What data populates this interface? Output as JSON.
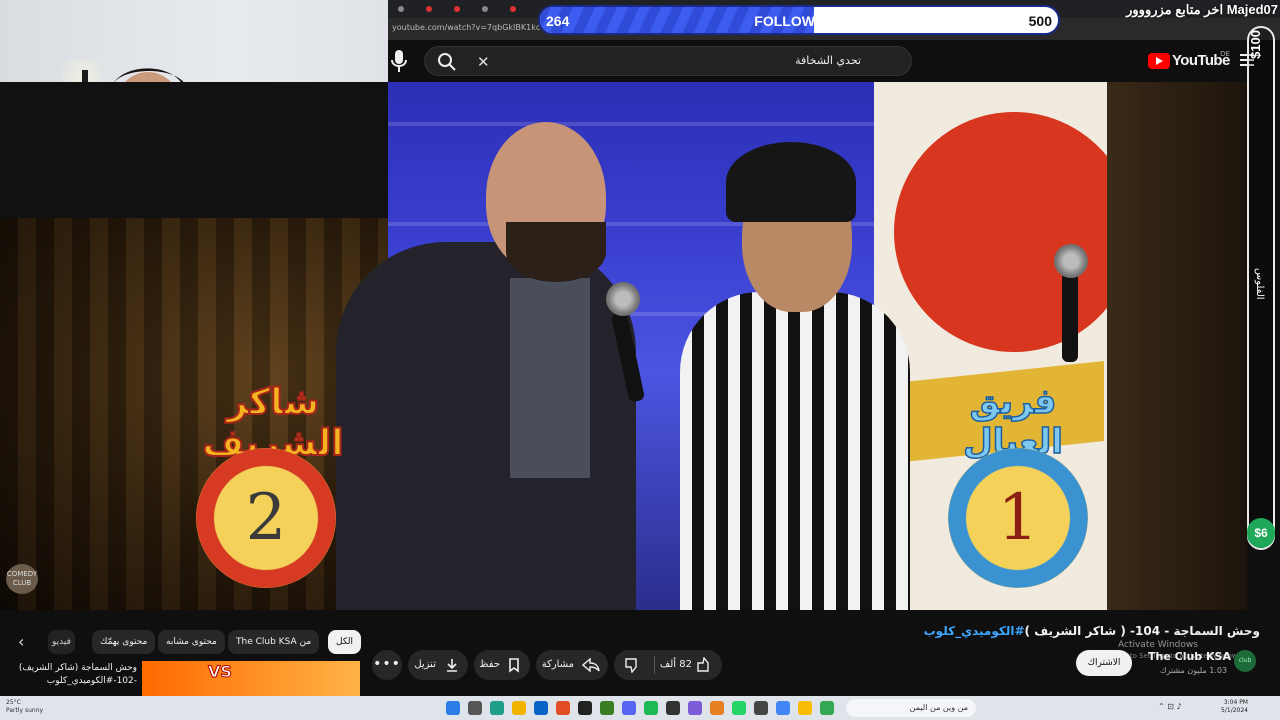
{
  "browser": {
    "url": "youtube.com/watch?v=7qbGkIBK1kc"
  },
  "overlay": {
    "followers_current": "264",
    "followers_label": "FOLLOWERS",
    "followers_goal": "500",
    "followers_progress": 0.528,
    "latest_follower": "اخر متابع مزرووور Majed07",
    "side_top": "$100",
    "side_mid": "الفلوس",
    "side_bottom": "$6"
  },
  "youtube": {
    "logo_text": "YouTube",
    "region": "DE",
    "search_query": "تحدي الشخافة",
    "video_title": "وحش السماجة - 104- ( شاكر الشريف )",
    "video_hashtag": "#الكوميدي_كلوب",
    "chips": [
      {
        "label": "الكل",
        "active": true
      },
      {
        "label": "من The Club KSA",
        "active": false
      },
      {
        "label": "محتوى مشابه",
        "active": false
      },
      {
        "label": "محتوى يهمّك",
        "active": false
      },
      {
        "label": "فيديو",
        "active": false
      }
    ],
    "related_title": "وحش السماجة (شاكر الشريف) -102-#الكوميدي_كلوب",
    "thumb_vs": "VS",
    "actions": {
      "like_count": "82 ألف",
      "share": "مشاركة",
      "save": "حفظ",
      "download": "تنزيل",
      "more": "•••"
    },
    "channel_name": "The Club KSA",
    "channel_subs": "1.03 مليون مشترك",
    "subscribe": "الاشتراك",
    "channel_avatar_text": "club"
  },
  "scene": {
    "left_name": "شاكر الشريف",
    "left_score": "2",
    "right_name": "فريق العيال",
    "right_score": "1",
    "watermark": "COMEDY CLUB"
  },
  "windows": {
    "activate_title": "Activate Windows",
    "activate_sub": "Go to Settings to activate Windows.",
    "taskbar_search": "من وين من اليمن",
    "weather_temp": "25°C",
    "weather_desc": "Partly sunny",
    "clock_time": "3:04 PM",
    "clock_date": "5/1/2024",
    "colors": {
      "accent_blue": "#3ea6ff",
      "youtube_red": "#ff0000",
      "goal_blue": "#2f4bd8",
      "money_green": "#1fa85a"
    }
  }
}
